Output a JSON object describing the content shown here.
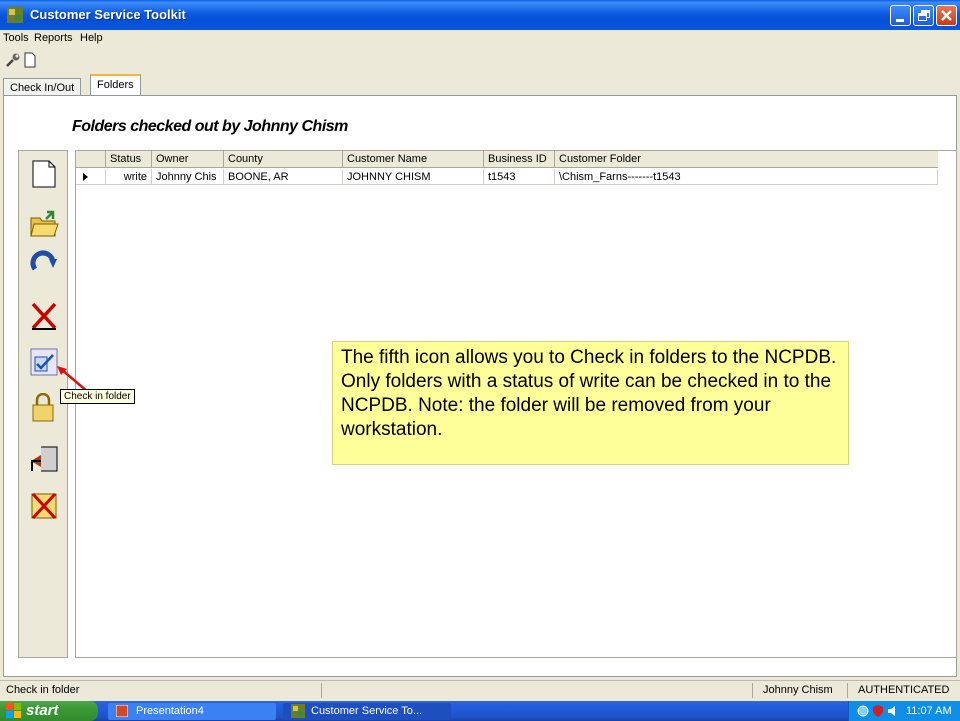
{
  "window": {
    "title": "Customer Service Toolkit"
  },
  "menu": [
    "Tools",
    "Reports",
    "Help"
  ],
  "tabs": [
    {
      "label": "Check In/Out",
      "active": false
    },
    {
      "label": "Folders",
      "active": true
    }
  ],
  "heading": "Folders checked out by Johnny Chism",
  "grid": {
    "columns": [
      "Status",
      "Owner",
      "County",
      "Customer Name",
      "Business ID",
      "Customer Folder"
    ],
    "rows": [
      [
        "write",
        "Johnny Chis",
        "BOONE, AR",
        "JOHNNY CHISM",
        "t1543",
        "\\Chism_Farns-------t1543"
      ]
    ]
  },
  "sidebar_icons": [
    "new-folder-icon",
    "open-folder-icon",
    "refresh-icon",
    "delete-icon",
    "check-in-folder-icon",
    "lock-folder-icon",
    "move-folder-icon",
    "remove-folder-icon"
  ],
  "tooltip": "Check in folder",
  "callout": "The fifth icon allows you to Check in folders to the NCPDB. Only folders with a status of write can be checked in to the NCPDB. Note: the folder will be removed from your workstation.",
  "statusbar": {
    "message": "Check in folder",
    "user": "Johnny Chism",
    "auth": "AUTHENTICATED"
  },
  "taskbar": {
    "start": "start",
    "tasks": [
      "Presentation4",
      "Customer Service To..."
    ],
    "clock": "11:07 AM"
  },
  "colors": {
    "titlebar": "#0a5fe6",
    "callout": "#ffff99",
    "start": "#3a9a35"
  }
}
